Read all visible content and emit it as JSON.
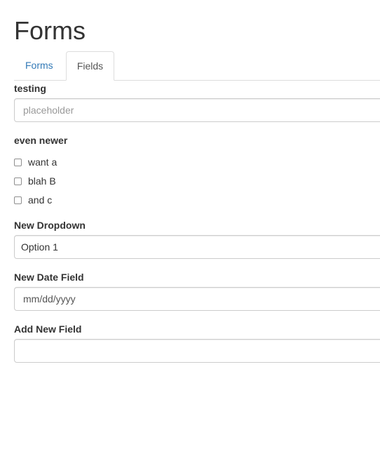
{
  "page": {
    "title": "Forms"
  },
  "tabs": [
    {
      "label": "Forms",
      "active": false
    },
    {
      "label": "Fields",
      "active": true
    }
  ],
  "fields": {
    "testing": {
      "label": "testing",
      "placeholder": "placeholder",
      "value": ""
    },
    "even_newer": {
      "label": "even newer",
      "options": [
        {
          "label": "want a",
          "checked": false
        },
        {
          "label": "blah B",
          "checked": false
        },
        {
          "label": "and c",
          "checked": false
        }
      ]
    },
    "new_dropdown": {
      "label": "New Dropdown",
      "selected": "Option 1"
    },
    "new_date_field": {
      "label": "New Date Field",
      "placeholder": "mm/dd/yyyy"
    },
    "add_new_field": {
      "label": "Add New Field",
      "value": ""
    }
  },
  "colors": {
    "link": "#337ab7",
    "text": "#333333",
    "border": "#cccccc",
    "tab_border": "#dddddd",
    "placeholder": "#999999"
  }
}
